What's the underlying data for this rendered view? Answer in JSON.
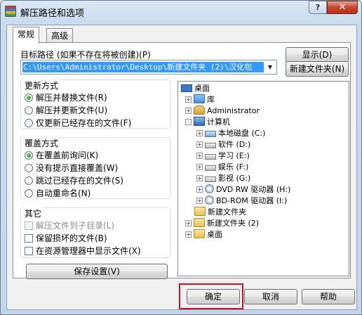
{
  "window": {
    "title": "解压路径和选项",
    "help_button": "?",
    "close_button": "✕"
  },
  "tabs": [
    {
      "label": "常规",
      "active": true
    },
    {
      "label": "高级",
      "active": false
    }
  ],
  "target_path": {
    "label": "目标路径 (如果不存在将被创建)(P)",
    "value": "C:\\Users\\Administrator\\Desktop\\新建文件夹 (2)\\汉化包"
  },
  "side_buttons": {
    "show": "显示(D)",
    "new_folder": "新建文件夹(N)"
  },
  "update_mode": {
    "title": "更新方式",
    "options": [
      {
        "label": "解压并替换文件(R)",
        "selected": true
      },
      {
        "label": "解压并更新文件(U)",
        "selected": false
      },
      {
        "label": "仅更新已经存在的文件(F)",
        "selected": false
      }
    ]
  },
  "overwrite_mode": {
    "title": "覆盖方式",
    "options": [
      {
        "label": "在覆盖前询问(K)",
        "selected": true
      },
      {
        "label": "没有提示直接覆盖(W)",
        "selected": false
      },
      {
        "label": "跳过已经存在的文件(S)",
        "selected": false
      },
      {
        "label": "自动重命名(N)",
        "selected": false
      }
    ]
  },
  "misc": {
    "title": "其它",
    "options": [
      {
        "label": "解压文件到子目录(L)",
        "checked": false,
        "disabled": true
      },
      {
        "label": "保留损坏的文件(B)",
        "checked": false,
        "disabled": false
      },
      {
        "label": "在资源管理器中显示文件(X)",
        "checked": false,
        "disabled": false
      }
    ]
  },
  "save_settings_button": "保存设置(V)",
  "tree": [
    {
      "label": "桌面",
      "icon": "desktop-icon",
      "expander": ""
    },
    {
      "label": "库",
      "icon": "library-icon",
      "expander": "+"
    },
    {
      "label": "Administrator",
      "icon": "user-folder-icon",
      "expander": "+"
    },
    {
      "label": "计算机",
      "icon": "computer-icon",
      "expander": "-"
    },
    {
      "label": "本地磁盘 (C:)",
      "icon": "system-drive-icon",
      "expander": "+"
    },
    {
      "label": "软件 (D:)",
      "icon": "drive-icon",
      "expander": "+"
    },
    {
      "label": "学习 (E:)",
      "icon": "drive-icon",
      "expander": "+"
    },
    {
      "label": "娱乐 (F:)",
      "icon": "drive-icon",
      "expander": "+"
    },
    {
      "label": "影视 (G:)",
      "icon": "drive-icon",
      "expander": "+"
    },
    {
      "label": "DVD RW 驱动器 (H:)",
      "icon": "optical-drive-icon",
      "expander": "+"
    },
    {
      "label": "BD-ROM 驱动器 (I:)",
      "icon": "optical-drive-icon",
      "expander": "+"
    },
    {
      "label": "新建文件夹",
      "icon": "folder-icon",
      "expander": ""
    },
    {
      "label": "新建文件夹 (2)",
      "icon": "folder-icon",
      "expander": "+"
    },
    {
      "label": "桌面",
      "icon": "folder-icon",
      "expander": "+"
    }
  ],
  "footer_buttons": {
    "ok": "确定",
    "cancel": "取消",
    "help": "帮助"
  },
  "highlight_color": "#c8102e"
}
